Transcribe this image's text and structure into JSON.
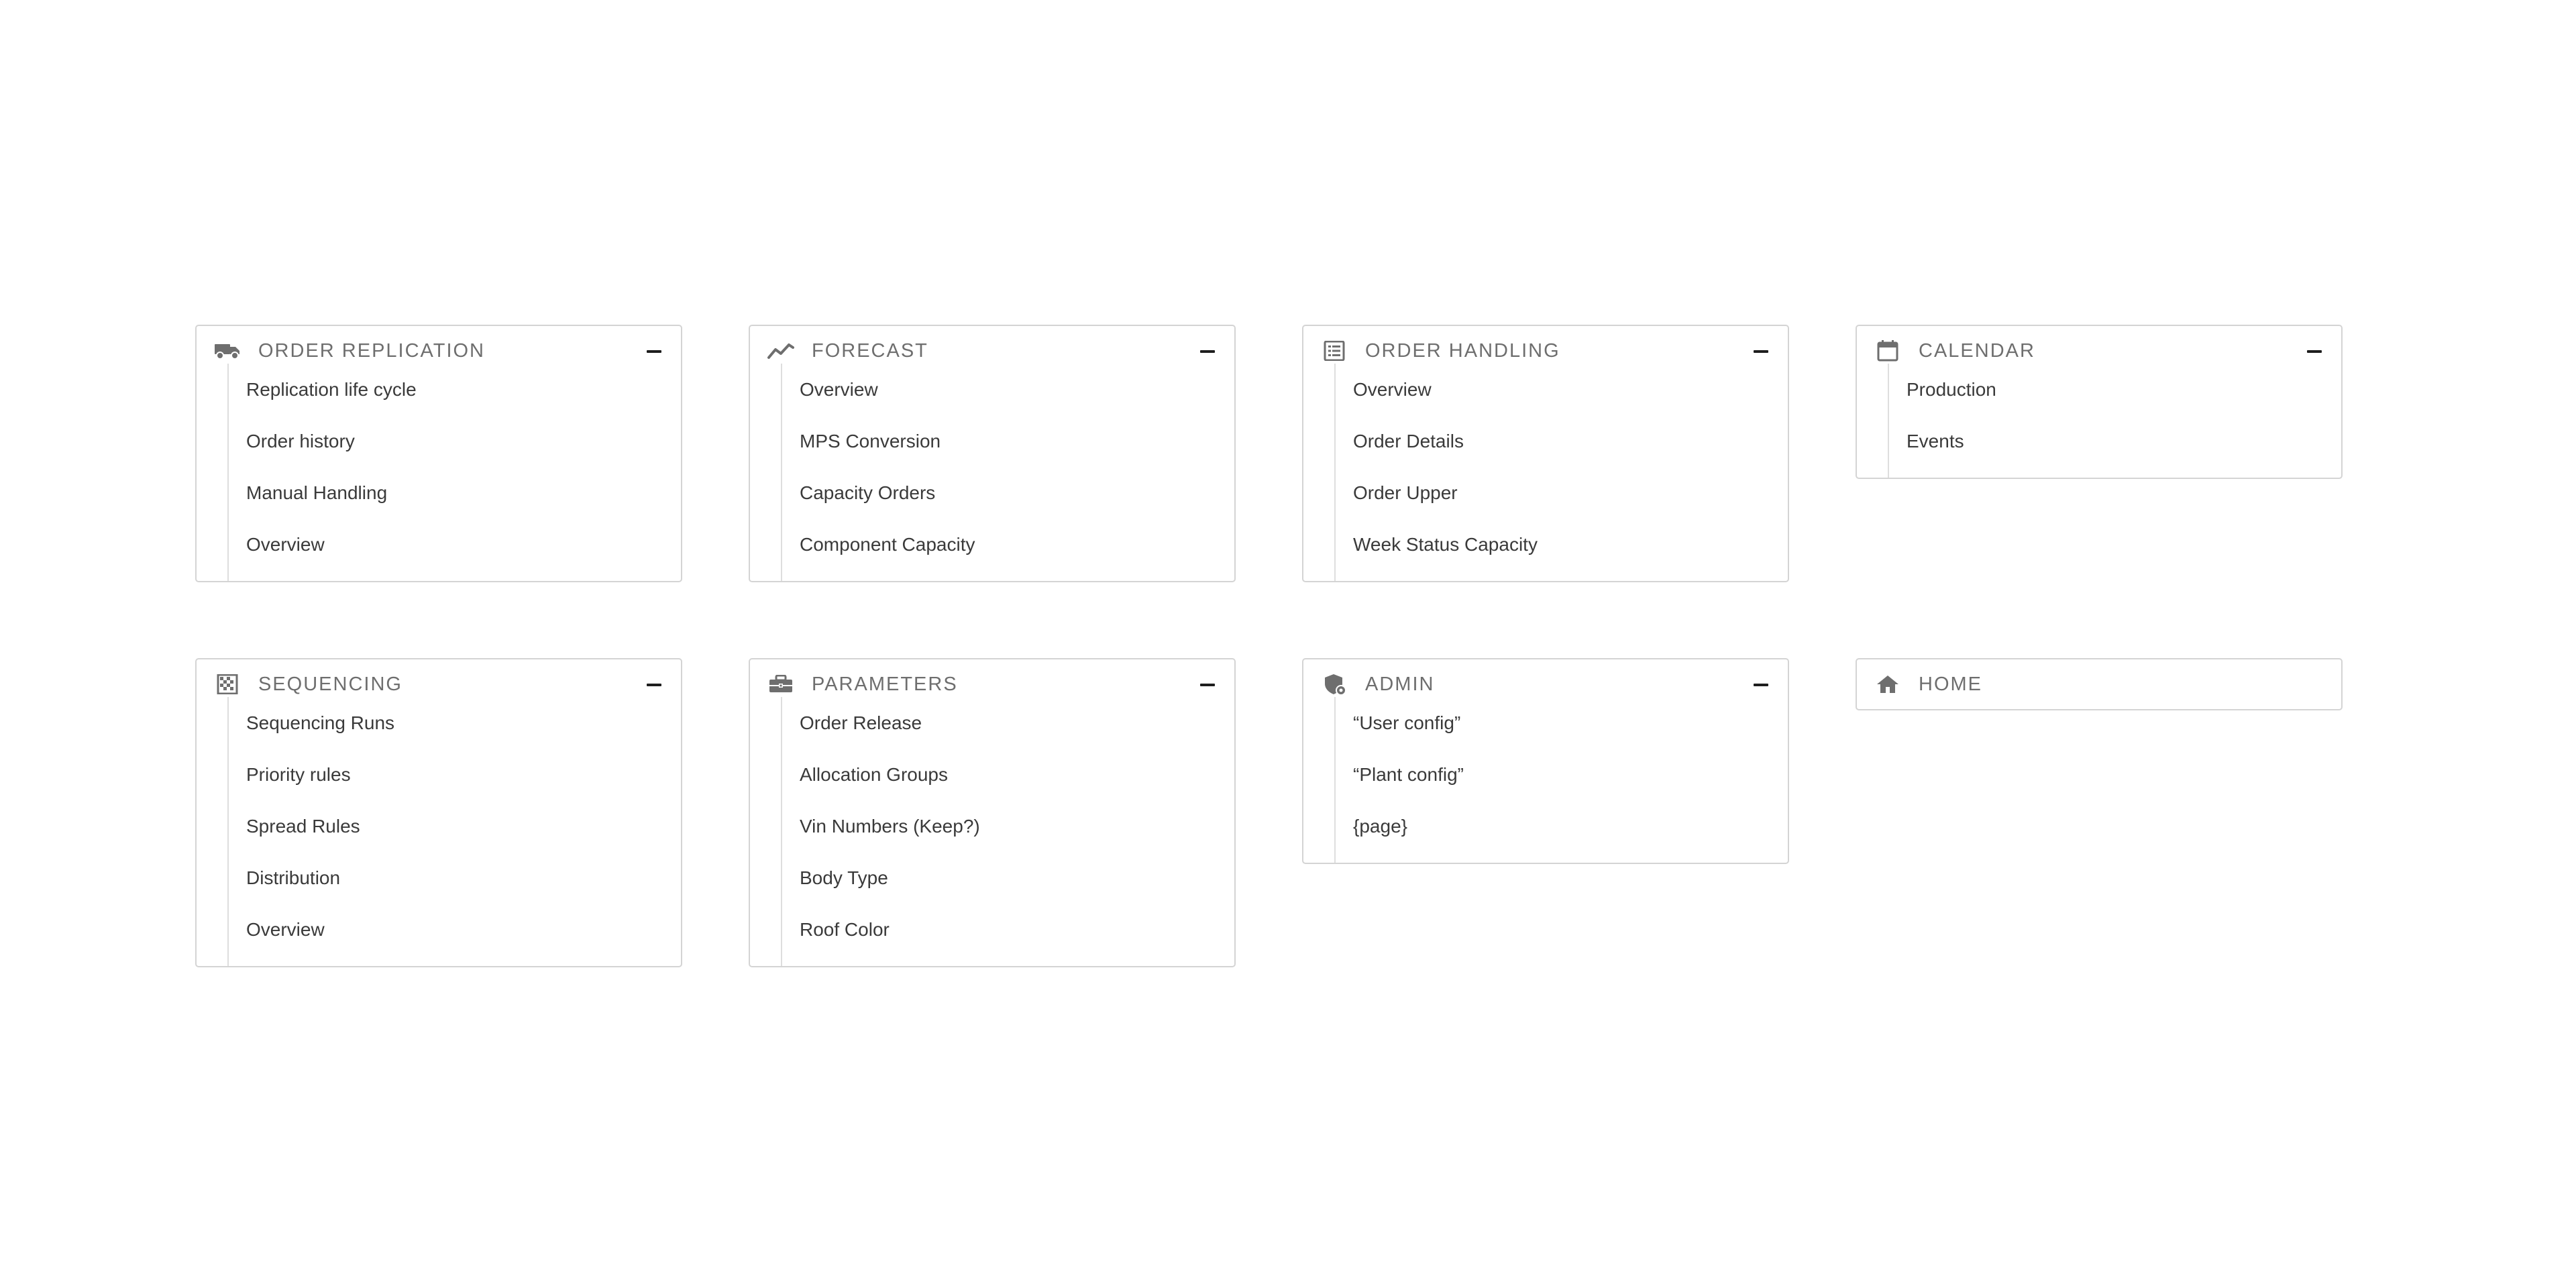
{
  "cards": {
    "order_replication": {
      "title": "ORDER REPLICATION",
      "icon": "truck-icon",
      "items": [
        "Replication life cycle",
        "Order history",
        "Manual Handling",
        "Overview"
      ]
    },
    "forecast": {
      "title": "FORECAST",
      "icon": "trending-line-icon",
      "items": [
        "Overview",
        "MPS Conversion",
        "Capacity Orders",
        "Component Capacity"
      ]
    },
    "order_handling": {
      "title": "ORDER HANDLING",
      "icon": "list-document-icon",
      "items": [
        "Overview",
        "Order Details",
        "Order Upper",
        "Week Status Capacity"
      ]
    },
    "calendar": {
      "title": "CALENDAR",
      "icon": "calendar-icon",
      "items": [
        "Production",
        "Events"
      ]
    },
    "sequencing": {
      "title": "SEQUENCING",
      "icon": "grid-icon",
      "items": [
        "Sequencing Runs",
        "Priority rules",
        "Spread Rules",
        "Distribution",
        "Overview"
      ]
    },
    "parameters": {
      "title": "PARAMETERS",
      "icon": "toolbox-icon",
      "items": [
        "Order Release",
        "Allocation Groups",
        "Vin Numbers (Keep?)",
        "Body Type",
        "Roof Color"
      ]
    },
    "admin": {
      "title": "ADMIN",
      "icon": "admin-shield-icon",
      "items": [
        "“User config”",
        "“Plant config”",
        "{page}"
      ]
    },
    "home": {
      "title": "HOME",
      "icon": "home-icon"
    }
  },
  "colors": {
    "border": "#d4d4d4",
    "title": "#6e6e6e",
    "text": "#3a3a3a",
    "icon": "#6e6e6e"
  }
}
